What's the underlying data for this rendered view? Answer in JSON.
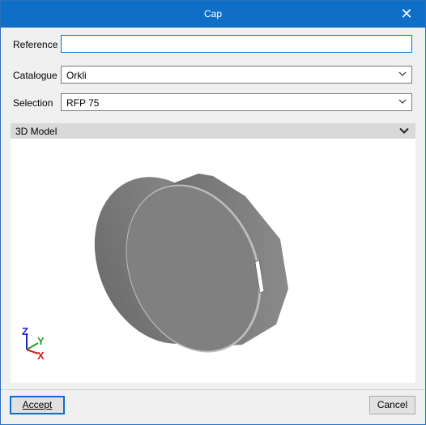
{
  "window": {
    "title": "Cap",
    "close_glyph": "✕"
  },
  "fields": {
    "reference": {
      "label": "Reference",
      "value": ""
    },
    "catalogue": {
      "label": "Catalogue",
      "value": "Orkli"
    },
    "selection": {
      "label": "Selection",
      "value": "RFP 75"
    }
  },
  "model_section": {
    "title": "3D Model"
  },
  "axes": {
    "z": "Z",
    "y": "Y",
    "x": "X"
  },
  "buttons": {
    "accept": "Accept",
    "cancel": "Cancel"
  },
  "colors": {
    "accent": "#0f6fc6",
    "model": "#7a7a7a"
  }
}
